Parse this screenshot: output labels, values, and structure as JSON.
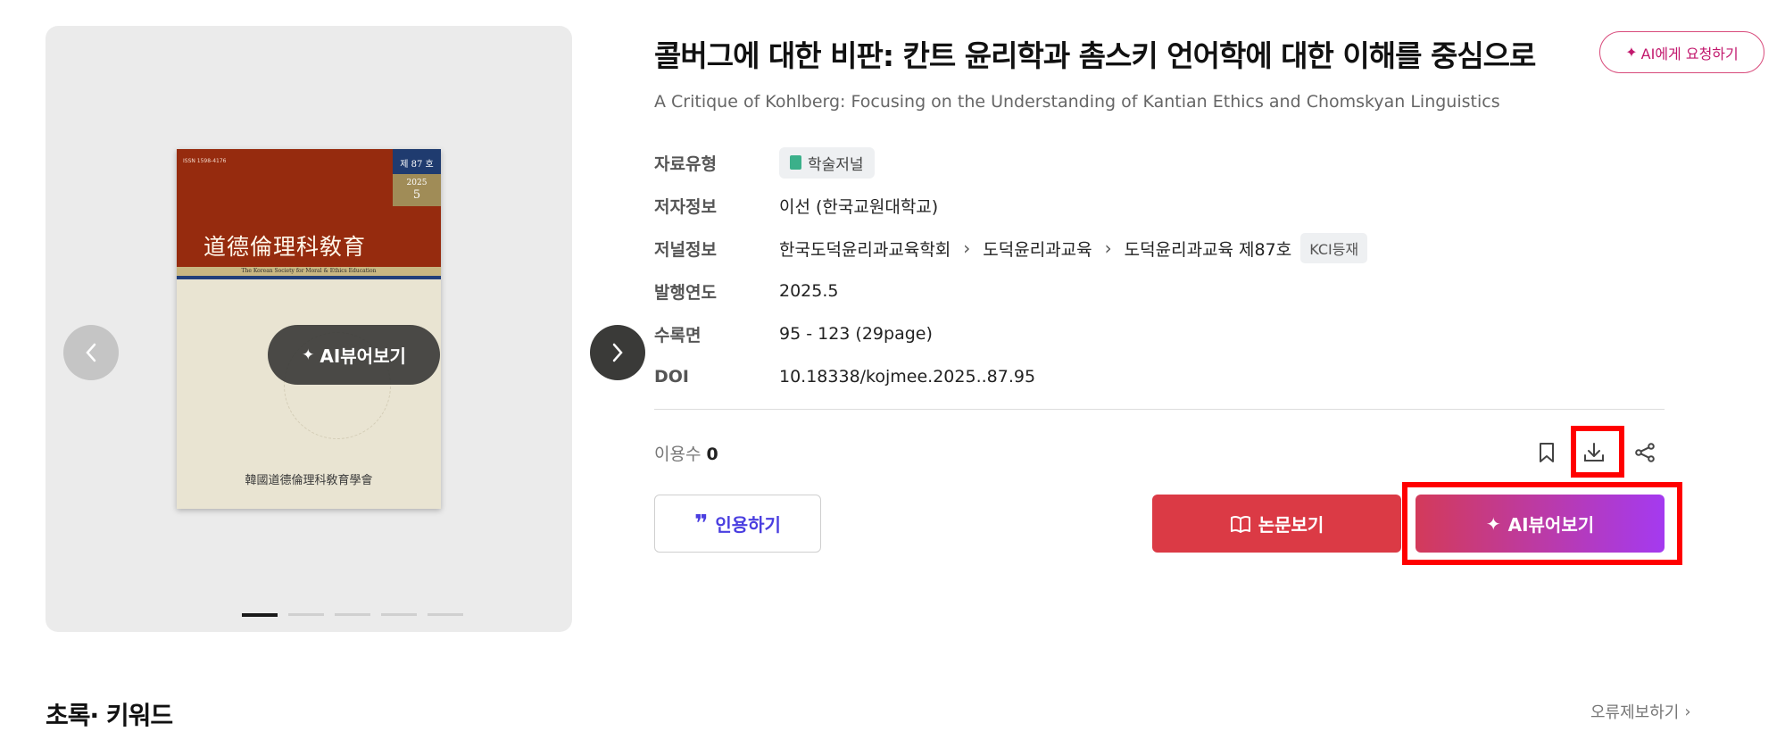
{
  "cover": {
    "issn": "ISSN 1598-4176",
    "issue_no": "제 87 호",
    "year": "2025",
    "month": "5",
    "journal_title": "道德倫理科敎育",
    "journal_en": "The Korean Society for Moral & Ethics Education",
    "publisher": "韓國道德倫理科敎育學會",
    "ai_viewer_label": "AI뷰어보기",
    "prev_icon": "chevron-left-icon",
    "next_icon": "chevron-right-icon",
    "slide_count": 5,
    "active_slide": 1
  },
  "article": {
    "title": "콜버그에 대한 비판: 칸트 윤리학과 촘스키 언어학에 대한 이해를 중심으로",
    "ai_request_label": "AI에게 요청하기",
    "subtitle": "A Critique of Kohlberg: Focusing on the Understanding of Kantian Ethics and Chomskyan Linguistics"
  },
  "meta": {
    "type_label": "자료유형",
    "type_value": "학술저널",
    "author_label": "저자정보",
    "author_value": "이선 (한국교원대학교)",
    "journal_label": "저널정보",
    "journal_path": [
      "한국도덕윤리과교육학회",
      "도덕윤리과교육",
      "도덕윤리과교육 제87호"
    ],
    "journal_badge": "KCI등재",
    "year_label": "발행연도",
    "year_value": "2025.5",
    "pages_label": "수록면",
    "pages_value": "95 - 123 (29page)",
    "doi_label": "DOI",
    "doi_value": "10.18338/kojmee.2025..87.95"
  },
  "usage": {
    "label": "이용수",
    "count": "0"
  },
  "actions": {
    "cite_label": "인용하기",
    "paper_label": "논문보기",
    "ai_viewer_label": "AI뷰어보기",
    "icons": [
      "bookmark-icon",
      "download-icon",
      "share-icon"
    ]
  },
  "footer": {
    "section_title": "초록· 키워드",
    "error_report_label": "오류제보하기"
  },
  "colors": {
    "paper_button": "#db3a45",
    "ai_gradient_start": "#d33a5a",
    "ai_gradient_end": "#a43af0",
    "cite_text": "#4a3ee0",
    "highlight": "#ff0000"
  }
}
